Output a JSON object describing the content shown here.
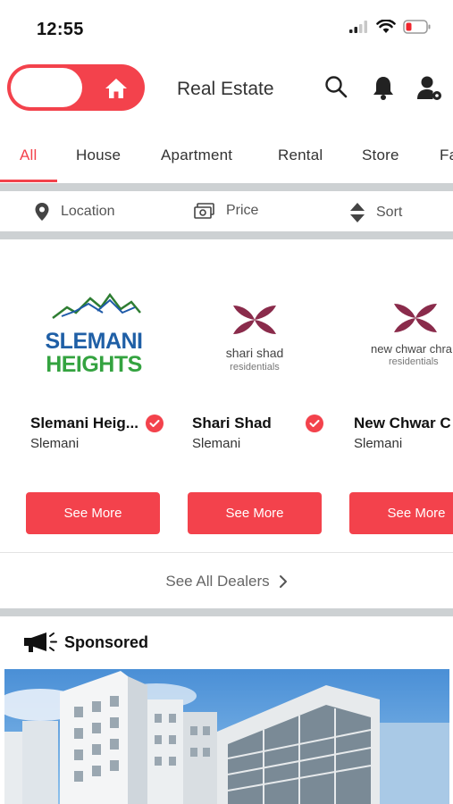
{
  "status": {
    "time": "12:55"
  },
  "header": {
    "title": "Real Estate"
  },
  "tabs": [
    {
      "label": "All"
    },
    {
      "label": "House"
    },
    {
      "label": "Apartment"
    },
    {
      "label": "Rental"
    },
    {
      "label": "Store"
    },
    {
      "label": "Fa"
    }
  ],
  "filters": {
    "location": "Location",
    "price": "Price",
    "sort": "Sort"
  },
  "dealers": [
    {
      "name": "Slemani Heig...",
      "city": "Slemani",
      "button": "See More",
      "logo_line1": "SLEMANI",
      "logo_line2": "HEIGHTS"
    },
    {
      "name": "Shari Shad",
      "city": "Slemani",
      "button": "See More",
      "logo_line1": "shari shad",
      "logo_line2": "residentials"
    },
    {
      "name": "New Chwar C",
      "city": "Slemani",
      "button": "See More",
      "logo_line1": "new chwar chra",
      "logo_line2": "residentials"
    }
  ],
  "see_all": "See All Dealers",
  "sponsored": "Sponsored",
  "colors": {
    "accent": "#f3424c",
    "divider": "#cdd1d3"
  }
}
